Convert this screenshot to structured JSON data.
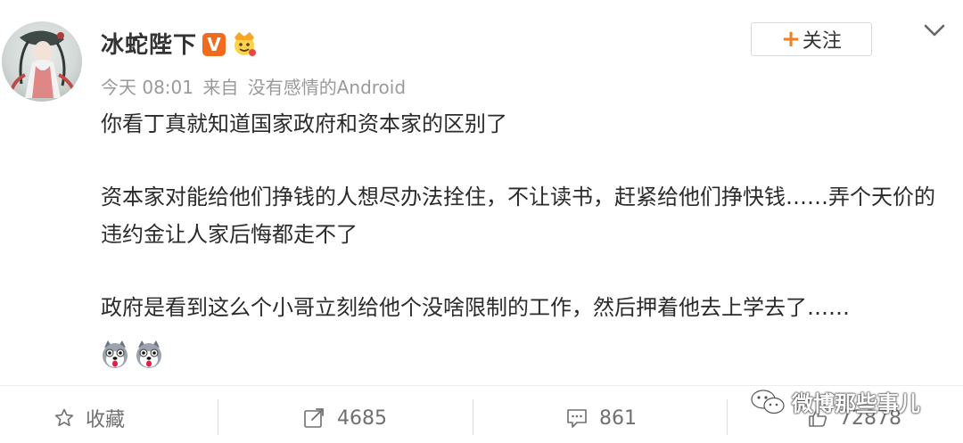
{
  "post": {
    "author": "冰蛇陛下",
    "verified_badge": "V",
    "timestamp": "今天 08:01",
    "source_prefix": "来自",
    "source": "没有感情的Android",
    "follow_label": "关注",
    "paragraphs": [
      "你看丁真就知道国家政府和资本家的区别了",
      "资本家对能给他们挣钱的人想尽办法拴住，不让读书，赶紧给他们挣快钱……弄个天价的违约金让人家后悔都走不了",
      "政府是看到这么个小哥立刻给他个没啥限制的工作，然后押着他去上学去了……"
    ]
  },
  "actions": {
    "favorite_label": "收藏",
    "repost_count": "4685",
    "comment_count": "861",
    "like_count": "72878"
  },
  "watermark": {
    "text": "微博那些事儿"
  },
  "colors": {
    "accent": "#f77e1e",
    "badge": "#f26b1d",
    "meta": "#9a9a9a"
  }
}
